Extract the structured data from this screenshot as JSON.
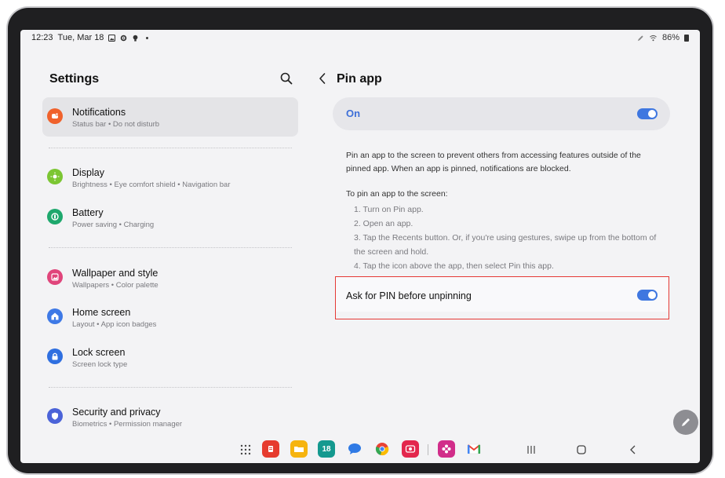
{
  "status_bar": {
    "time": "12:23",
    "date": "Tue, Mar 18",
    "battery": "86%",
    "left_icons": [
      "gallery-icon",
      "gear-icon",
      "bulb-icon",
      "dot-icon"
    ],
    "right_icons": [
      "pen-icon",
      "wifi-icon",
      "battery-icon"
    ]
  },
  "left_pane": {
    "title": "Settings",
    "items": [
      {
        "title": "Notifications",
        "subtitle": "Status bar  •  Do not disturb",
        "icon": "bell-icon",
        "color": "#f0622c"
      },
      {
        "title": "Display",
        "subtitle": "Brightness  •  Eye comfort shield  •  Navigation bar",
        "icon": "sun-icon",
        "color": "#7cc633"
      },
      {
        "title": "Battery",
        "subtitle": "Power saving  •  Charging",
        "icon": "battery-icon",
        "color": "#1ea86d"
      },
      {
        "title": "Wallpaper and style",
        "subtitle": "Wallpapers  •  Color palette",
        "icon": "image-icon",
        "color": "#e0457b"
      },
      {
        "title": "Home screen",
        "subtitle": "Layout  •  App icon badges",
        "icon": "home-icon",
        "color": "#3e79e6"
      },
      {
        "title": "Lock screen",
        "subtitle": "Screen lock type",
        "icon": "lock-icon",
        "color": "#2f6fe0"
      },
      {
        "title": "Security and privacy",
        "subtitle": "Biometrics  •  Permission manager",
        "icon": "shield-icon",
        "color": "#4b63d8"
      }
    ]
  },
  "right_pane": {
    "title": "Pin app",
    "on_label": "On",
    "description": "Pin an app to the screen to prevent others from accessing features outside of the pinned app. When an app is pinned, notifications are blocked.",
    "steps_heading": "To pin an app to the screen:",
    "steps": [
      "1. Turn on Pin app.",
      "2. Open an app.",
      "3. Tap the Recents button. Or, if you're using gestures, swipe up from the bottom of the screen and hold.",
      "4. Tap the icon above the app, then select Pin this app."
    ],
    "pin_option_label": "Ask for PIN before unpinning"
  },
  "colors": {
    "accent": "#3f77e0",
    "highlight_border": "#e53935"
  },
  "dock": {
    "apps": [
      "notes-app-icon",
      "files-app-icon",
      "calendar-app-icon",
      "messages-app-icon",
      "chrome-app-icon",
      "camera-app-icon",
      "bixby-app-icon",
      "gmail-app-icon"
    ],
    "calendar_day": "18",
    "nav": [
      "recents-nav-icon",
      "home-nav-icon",
      "back-nav-icon"
    ]
  }
}
